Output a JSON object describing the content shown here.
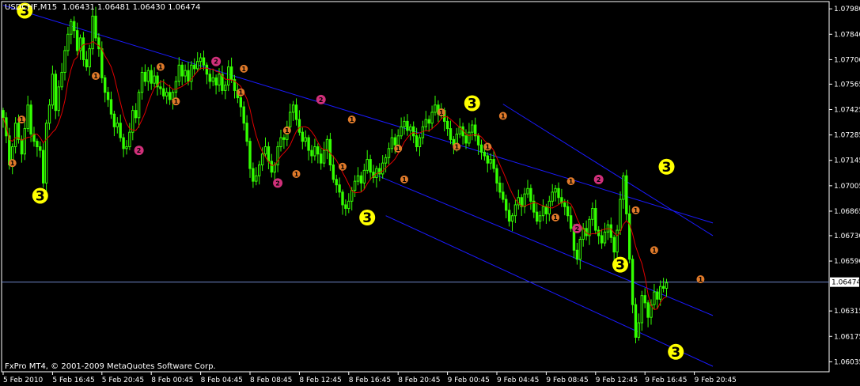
{
  "header": {
    "symbol_tf": "USDCHF,M15",
    "quote": "1.06431 1.06481 1.06430 1.06474"
  },
  "footer": {
    "copyright": "FxPro MT4, © 2001-2009 MetaQuotes Software Corp."
  },
  "colors": {
    "background": "#000000",
    "candle": "#33ff00",
    "ma_line": "#e00000",
    "channel": "#1a1aff",
    "current_price_line": "#6f86c8",
    "axis": "#ffffff",
    "label_big": "#ffff00",
    "label_small_orange": "#e07a2a",
    "label_small_magenta": "#d0307a"
  },
  "chart_data": {
    "type": "candlestick",
    "y_axis": {
      "range": [
        1.0598,
        1.0802
      ],
      "ticks": [
        "1.07980",
        "1.07840",
        "1.07700",
        "1.07565",
        "1.07425",
        "1.07285",
        "1.07145",
        "1.07005",
        "1.06865",
        "1.06730",
        "1.06590",
        "1.06315",
        "1.06175",
        "1.06035"
      ],
      "tick_values": [
        1.0798,
        1.0784,
        1.077,
        1.07565,
        1.07425,
        1.07285,
        1.07145,
        1.07005,
        1.06865,
        1.0673,
        1.0659,
        1.06315,
        1.06175,
        1.06035
      ]
    },
    "x_axis": {
      "ticks": [
        "5 Feb 2010",
        "5 Feb 16:45",
        "5 Feb 20:45",
        "8 Feb 00:45",
        "8 Feb 04:45",
        "8 Feb 08:45",
        "8 Feb 12:45",
        "8 Feb 16:45",
        "8 Feb 20:45",
        "9 Feb 00:45",
        "9 Feb 04:45",
        "9 Feb 08:45",
        "9 Feb 12:45",
        "9 Feb 16:45",
        "9 Feb 20:45"
      ],
      "tick_index": [
        0,
        16,
        32,
        48,
        64,
        80,
        96,
        112,
        128,
        144,
        160,
        176,
        192,
        208,
        224
      ]
    },
    "current_price": 1.06474,
    "current_price_label": "1.06474",
    "closes": [
      1.0738,
      1.0728,
      1.0712,
      1.0722,
      1.0735,
      1.0726,
      1.0718,
      1.0732,
      1.0745,
      1.0729,
      1.0725,
      1.0722,
      1.072,
      1.0702,
      1.0735,
      1.0745,
      1.0762,
      1.0742,
      1.0755,
      1.0763,
      1.0775,
      1.0784,
      1.0791,
      1.0786,
      1.0775,
      1.0782,
      1.077,
      1.0766,
      1.0776,
      1.0794,
      1.0782,
      1.0776,
      1.076,
      1.0752,
      1.0748,
      1.074,
      1.0733,
      1.0735,
      1.0727,
      1.0721,
      1.0722,
      1.073,
      1.0742,
      1.0738,
      1.0752,
      1.0763,
      1.0758,
      1.0764,
      1.0757,
      1.0761,
      1.0755,
      1.0754,
      1.075,
      1.0752,
      1.0748,
      1.0752,
      1.0758,
      1.0767,
      1.0761,
      1.0764,
      1.0758,
      1.0767,
      1.0765,
      1.0769,
      1.0771,
      1.0767,
      1.0762,
      1.0758,
      1.076,
      1.0756,
      1.0762,
      1.0753,
      1.0756,
      1.0766,
      1.0759,
      1.0753,
      1.0749,
      1.0744,
      1.0735,
      1.0725,
      1.071,
      1.0703,
      1.0706,
      1.0712,
      1.0718,
      1.0722,
      1.0714,
      1.0708,
      1.0712,
      1.0722,
      1.0727,
      1.0726,
      1.0733,
      1.0741,
      1.0745,
      1.0737,
      1.073,
      1.0725,
      1.0727,
      1.072,
      1.0717,
      1.0722,
      1.0718,
      1.0713,
      1.072,
      1.0726,
      1.0712,
      1.0704,
      1.0701,
      1.0697,
      1.069,
      1.0688,
      1.0692,
      1.0698,
      1.0703,
      1.0706,
      1.0702,
      1.0709,
      1.0715,
      1.0708,
      1.0705,
      1.071,
      1.0707,
      1.0713,
      1.0716,
      1.0721,
      1.0727,
      1.0723,
      1.0728,
      1.0733,
      1.0736,
      1.0731,
      1.0733,
      1.0728,
      1.0722,
      1.0727,
      1.0733,
      1.0737,
      1.0735,
      1.0741,
      1.0745,
      1.074,
      1.0742,
      1.0736,
      1.0732,
      1.0726,
      1.0723,
      1.0729,
      1.0733,
      1.0728,
      1.0724,
      1.073,
      1.0734,
      1.0728,
      1.0723,
      1.0719,
      1.0717,
      1.0713,
      1.0715,
      1.071,
      1.0702,
      1.0697,
      1.0693,
      1.0687,
      1.0681,
      1.0684,
      1.069,
      1.0694,
      1.0689,
      1.0696,
      1.0699,
      1.0692,
      1.0686,
      1.0681,
      1.0684,
      1.0689,
      1.0685,
      1.0692,
      1.0697,
      1.0699,
      1.0694,
      1.0691,
      1.0689,
      1.0684,
      1.0677,
      1.0665,
      1.066,
      1.0671,
      1.0677,
      1.0673,
      1.0682,
      1.0688,
      1.0676,
      1.0673,
      1.0669,
      1.0675,
      1.0679,
      1.0672,
      1.0664,
      1.0676,
      1.0693,
      1.0706,
      1.0685,
      1.066,
      1.0635,
      1.0617,
      1.0625,
      1.064,
      1.0636,
      1.0628,
      1.0635,
      1.0642,
      1.0638,
      1.0645,
      1.0644,
      1.0647
    ],
    "channels": [
      {
        "name": "upper",
        "from": {
          "i": 0,
          "price": 1.08
        },
        "to": {
          "i": 230,
          "price": 1.068
        }
      },
      {
        "name": "upper2",
        "from": {
          "i": 162,
          "price": 1.07455
        },
        "to": {
          "i": 230,
          "price": 1.0673
        }
      },
      {
        "name": "middle",
        "from": {
          "i": 120,
          "price": 1.0707
        },
        "to": {
          "i": 230,
          "price": 1.0629
        }
      },
      {
        "name": "lower",
        "from": {
          "i": 124,
          "price": 1.0684
        },
        "to": {
          "i": 230,
          "price": 1.0601
        }
      }
    ],
    "wave_labels": [
      {
        "text": "3",
        "size": "big",
        "i": 7,
        "price": 1.0797
      },
      {
        "text": "3",
        "size": "big",
        "i": 12,
        "price": 1.0695
      },
      {
        "text": "3",
        "size": "big",
        "i": 118,
        "price": 1.0683
      },
      {
        "text": "3",
        "size": "big",
        "i": 152,
        "price": 1.0746
      },
      {
        "text": "3",
        "size": "big",
        "i": 200,
        "price": 1.0657
      },
      {
        "text": "3",
        "size": "big",
        "i": 215,
        "price": 1.0711
      },
      {
        "text": "3",
        "size": "big",
        "i": 218,
        "price": 1.0609
      },
      {
        "text": "2",
        "size": "small",
        "color": "magenta",
        "i": 44,
        "price": 1.072
      },
      {
        "text": "2",
        "size": "small",
        "color": "magenta",
        "i": 69,
        "price": 1.0769
      },
      {
        "text": "2",
        "size": "small",
        "color": "magenta",
        "i": 89,
        "price": 1.0702
      },
      {
        "text": "2",
        "size": "small",
        "color": "magenta",
        "i": 103,
        "price": 1.0748
      },
      {
        "text": "2",
        "size": "small",
        "color": "magenta",
        "i": 186,
        "price": 1.0677
      },
      {
        "text": "2",
        "size": "small",
        "color": "magenta",
        "i": 193,
        "price": 1.0704
      },
      {
        "text": "1",
        "size": "small",
        "color": "orange",
        "i": 3,
        "price": 1.0713
      },
      {
        "text": "1",
        "size": "small",
        "color": "orange",
        "i": 6,
        "price": 1.0737
      },
      {
        "text": "1",
        "size": "small",
        "color": "orange",
        "i": 30,
        "price": 1.0761
      },
      {
        "text": "1",
        "size": "small",
        "color": "orange",
        "i": 51,
        "price": 1.0766
      },
      {
        "text": "1",
        "size": "small",
        "color": "orange",
        "i": 56,
        "price": 1.0747
      },
      {
        "text": "1",
        "size": "small",
        "color": "orange",
        "i": 78,
        "price": 1.0765
      },
      {
        "text": "1",
        "size": "small",
        "color": "orange",
        "i": 77,
        "price": 1.0752
      },
      {
        "text": "1",
        "size": "small",
        "color": "orange",
        "i": 92,
        "price": 1.0731
      },
      {
        "text": "1",
        "size": "small",
        "color": "orange",
        "i": 95,
        "price": 1.0707
      },
      {
        "text": "1",
        "size": "small",
        "color": "orange",
        "i": 110,
        "price": 1.0711
      },
      {
        "text": "1",
        "size": "small",
        "color": "orange",
        "i": 113,
        "price": 1.0737
      },
      {
        "text": "1",
        "size": "small",
        "color": "orange",
        "i": 128,
        "price": 1.0721
      },
      {
        "text": "1",
        "size": "small",
        "color": "orange",
        "i": 130,
        "price": 1.0704
      },
      {
        "text": "1",
        "size": "small",
        "color": "orange",
        "i": 142,
        "price": 1.0741
      },
      {
        "text": "1",
        "size": "small",
        "color": "orange",
        "i": 147,
        "price": 1.0722
      },
      {
        "text": "1",
        "size": "small",
        "color": "orange",
        "i": 157,
        "price": 1.0722
      },
      {
        "text": "1",
        "size": "small",
        "color": "orange",
        "i": 162,
        "price": 1.0739
      },
      {
        "text": "1",
        "size": "small",
        "color": "orange",
        "i": 179,
        "price": 1.0683
      },
      {
        "text": "1",
        "size": "small",
        "color": "orange",
        "i": 184,
        "price": 1.0703
      },
      {
        "text": "1",
        "size": "small",
        "color": "orange",
        "i": 205,
        "price": 1.0687
      },
      {
        "text": "1",
        "size": "small",
        "color": "orange",
        "i": 211,
        "price": 1.0665
      },
      {
        "text": "1",
        "size": "small",
        "color": "orange",
        "i": 226,
        "price": 1.0649
      }
    ]
  }
}
